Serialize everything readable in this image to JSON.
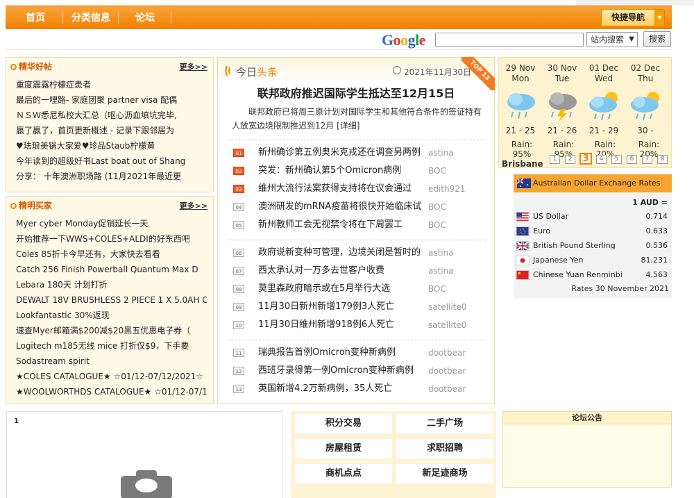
{
  "nav": {
    "items": [
      "首页",
      "分类信息",
      "论坛"
    ],
    "quick_nav": "快捷导航"
  },
  "search": {
    "logo": "Google",
    "scope": "站内搜索",
    "button": "搜索"
  },
  "featured": {
    "title": "精华好帖",
    "more": "更多>>",
    "items": [
      "重度震露柠檬症患者",
      "最后的一哩路- 家庭团聚 partner visa 配偶",
      "ＮＳＷ悉尼私校大汇总（呕心沥血填坑完毕,",
      "贏了贏了，首页更新概述 - 记录下跟邻居为",
      "♥珐琅美锅大家爱♥珍品Staub柠檬黄",
      "今年读到的超级好书Last boat out of Shang",
      "分享： 十年澳洲职场路 (11月2021年最近更"
    ]
  },
  "deals": {
    "title": "精明买家",
    "more": "更多>>",
    "items": [
      "Myer cyber Monday促销延长一天",
      "开始推荐一下WWS+COLES+ALDI的好东西吧",
      "Coles 85折卡今早还有，大家快去看看",
      "Catch 256 Finish Powerball Quantum Max D",
      "Lebara 180天 计划打折",
      "DEWALT 18V BRUSHLESS 2 PIECE 1 X 5.0AH C",
      "Lookfantastic 30%返现",
      "速查Myer邮箱满$200减$20黑五优惠电子券（",
      "Logitech m185无线 mice 打折仅$9，下手要",
      "Sodastream spirit",
      "★COLES CATALOGUE★ ☆01/12-07/12/2021☆",
      "★WOOLWORTHDS CATALOGUE★ ☆01/12-07/12/"
    ]
  },
  "today": {
    "label_a": "今日",
    "label_b": "头条",
    "date": "2021年11月30日",
    "ribbon": "TOP 13",
    "headline": "联邦政府推迟国际学生抵达至12月15日",
    "summary": "联邦政府已将周三原计划对国际学生和其他符合条件的签证持有人放宽边境限制推迟到12月",
    "detail": "[详细]",
    "news": [
      {
        "num": "01",
        "title": "新州确诊第五例奥米克戎还在调查另两例",
        "author": "astina"
      },
      {
        "num": "02",
        "title": "突发：新州确认第5个Omicron病例",
        "author": "BOC"
      },
      {
        "num": "03",
        "title": "维州大流行法案获得支持将在议会通过",
        "author": "edith921"
      },
      {
        "num": "04",
        "title": "澳洲研发的mRNA疫苗将很快开始临床试",
        "author": "BOC"
      },
      {
        "num": "05",
        "title": "新州教师工会无视禁令将在下周罢工",
        "author": "BOC"
      },
      {
        "num": "06",
        "title": "政府说新变种可管理，边境关闭是暂时的",
        "author": "astina"
      },
      {
        "num": "07",
        "title": "西太承认对一万多去世客户收费",
        "author": "astina"
      },
      {
        "num": "08",
        "title": "莫里森政府暗示或在5月举行大选",
        "author": "BOC"
      },
      {
        "num": "09",
        "title": "11月30日新州新增179例3人死亡",
        "author": "satellite0"
      },
      {
        "num": "10",
        "title": "11月30日维州新增918例6人死亡",
        "author": "satellite0"
      },
      {
        "num": "11",
        "title": "瑞典报告首例Omicron变种新病例",
        "author": "dootbear"
      },
      {
        "num": "12",
        "title": "西班牙录得第一例Omicron变种新病例",
        "author": "dootbear"
      },
      {
        "num": "13",
        "title": "英国新增4.2万新病例，35人死亡",
        "author": "dootbear"
      }
    ]
  },
  "weather": {
    "city": "Brisbane",
    "days": [
      {
        "date": "29 Nov",
        "day": "Mon",
        "temp": "21 - 25",
        "rain": "Rain: 95%",
        "icon": "rain-cloud-icon"
      },
      {
        "date": "30 Nov",
        "day": "Tue",
        "temp": "21 - 26",
        "rain": "Rain: 95%",
        "icon": "storm-cloud-icon"
      },
      {
        "date": "01 Dec",
        "day": "Wed",
        "temp": "21 - 29",
        "rain": "Rain: 70%",
        "icon": "sun-rain-cloud-icon"
      },
      {
        "date": "02 Dec",
        "day": "Thu",
        "temp": "30 -",
        "rain": "Rain: 20%",
        "icon": "sun-rain-cloud-icon"
      }
    ],
    "pages": [
      "1",
      "2",
      "3",
      "4",
      "5",
      "6",
      "7",
      "8"
    ],
    "active_page": "3"
  },
  "fx": {
    "title": "Australian Dollar Exchange Rates",
    "base": "1 AUD =",
    "rates": [
      {
        "name": "US Dollar",
        "value": "0.714",
        "flag": "us-flag-icon"
      },
      {
        "name": "Euro",
        "value": "0.633",
        "flag": "eu-flag-icon"
      },
      {
        "name": "British Pound Sterling",
        "value": "0.536",
        "flag": "uk-flag-icon"
      },
      {
        "name": "Japanese Yen",
        "value": "81.231",
        "flag": "jp-flag-icon"
      },
      {
        "name": "Chinese Yuan Renminbi",
        "value": "4.563",
        "flag": "cn-flag-icon"
      }
    ],
    "date": "Rates 30 November 2021"
  },
  "bottom": {
    "slide_num": "1",
    "grid": [
      "积分交易",
      "二手广场",
      "房屋租赁",
      "求职招聘",
      "商机点点",
      "新足迹商场"
    ],
    "notice_title": "论坛公告"
  }
}
